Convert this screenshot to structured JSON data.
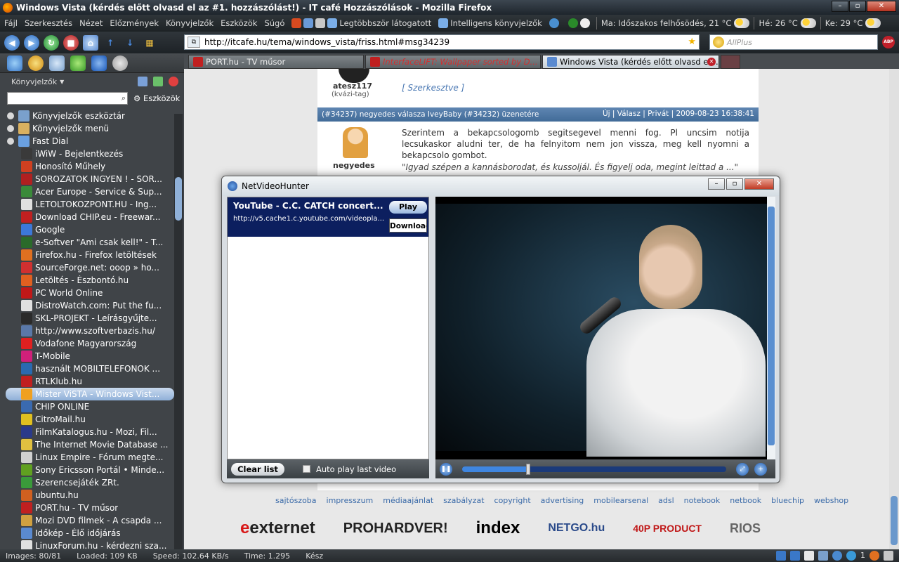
{
  "window": {
    "title": "Windows Vista (kérdés előtt olvasd el az #1. hozzászólást!) - IT café Hozzászólások - Mozilla Firefox"
  },
  "menu": {
    "items": [
      "Fájl",
      "Szerkesztés",
      "Nézet",
      "Előzmények",
      "Könyvjelzők",
      "Eszközök",
      "Súgó"
    ],
    "most_visited": "Legtöbbször látogatott",
    "smart_bookmarks": "Intelligens könyvjelzők",
    "weather_now": "Ma: Időszakos felhősödés, 21 °C",
    "weather_mon": "Hé: 26 °C",
    "weather_tue": "Ke: 29 °C"
  },
  "nav": {
    "url": "http://itcafe.hu/tema/windows_vista/friss.html#msg34239",
    "search_placeholder": "AllPlus",
    "adblock_label": "ABP"
  },
  "sidebar": {
    "title": "Könyvjelzők",
    "tools_label": "Eszközök",
    "tree": [
      {
        "label": "Könyvjelzők eszköztár",
        "level": 0,
        "color": "#7aa0cc"
      },
      {
        "label": "Könyvjelzők menü",
        "level": 0,
        "color": "#d8b060"
      },
      {
        "label": "Fast Dial",
        "level": 1,
        "color": "#6aa0e0"
      },
      {
        "label": "iWiW - Bejelentkezés",
        "level": 2,
        "color": "#3a3a3a"
      },
      {
        "label": "Honosító Műhely",
        "level": 2,
        "color": "#d04020"
      },
      {
        "label": "SOROZATOK INGYEN ! - SOR...",
        "level": 2,
        "color": "#b02020"
      },
      {
        "label": "Acer Europe - Service & Sup...",
        "level": 2,
        "color": "#3a8a3a"
      },
      {
        "label": "LETOLTOKOZPONT.HU - Ing...",
        "level": 2,
        "color": "#e0e0e0"
      },
      {
        "label": "Download CHIP.eu - Freewar...",
        "level": 2,
        "color": "#c02020"
      },
      {
        "label": "Google",
        "level": 2,
        "color": "#3c78d8"
      },
      {
        "label": "e-Softver \"Ami csak kell!\" - T...",
        "level": 2,
        "color": "#2a6a2a"
      },
      {
        "label": "Firefox.hu - Firefox letöltések",
        "level": 2,
        "color": "#e07020"
      },
      {
        "label": "SourceForge.net: ooop » ho...",
        "level": 2,
        "color": "#d03030"
      },
      {
        "label": "Letöltés - Észbontó.hu",
        "level": 2,
        "color": "#e06020"
      },
      {
        "label": "PC World Online",
        "level": 2,
        "color": "#c01818"
      },
      {
        "label": "DistroWatch.com: Put the fu...",
        "level": 2,
        "color": "#e0e0e0"
      },
      {
        "label": "SKL-PROJEKT - Leírásgyűjte...",
        "level": 2,
        "color": "#2a2a2a"
      },
      {
        "label": "http://www.szoftverbazis.hu/",
        "level": 2,
        "color": "#5a78a8"
      },
      {
        "label": "Vodafone Magyarország",
        "level": 2,
        "color": "#e02020"
      },
      {
        "label": "T-Mobile",
        "level": 2,
        "color": "#d0207a"
      },
      {
        "label": "használt MOBILTELEFONOK ...",
        "level": 2,
        "color": "#2a6ab0"
      },
      {
        "label": "RTLKlub.hu",
        "level": 2,
        "color": "#c02020"
      },
      {
        "label": "Mister ViSTA - Windows Vist...",
        "level": 2,
        "color": "#f0a020",
        "selected": true
      },
      {
        "label": "CHIP ONLINE",
        "level": 2,
        "color": "#3a6ab0"
      },
      {
        "label": "CitroMail.hu",
        "level": 2,
        "color": "#e0c020"
      },
      {
        "label": "FilmKatalogus.hu - Mozi, Fil...",
        "level": 2,
        "color": "#2a3a8a"
      },
      {
        "label": "The Internet Movie Database ...",
        "level": 2,
        "color": "#e0c040"
      },
      {
        "label": "Linux Empire - Fórum megte...",
        "level": 2,
        "color": "#d0d0d0"
      },
      {
        "label": "Sony Ericsson Portál • Minde...",
        "level": 2,
        "color": "#60a020"
      },
      {
        "label": "Szerencsejáték ZRt.",
        "level": 2,
        "color": "#3a9a3a"
      },
      {
        "label": "ubuntu.hu",
        "level": 2,
        "color": "#d06020"
      },
      {
        "label": "PORT.hu - TV műsor",
        "level": 2,
        "color": "#c02020"
      },
      {
        "label": "Mozi DVD filmek - A csapda ...",
        "level": 2,
        "color": "#d0a040"
      },
      {
        "label": "Időkép - Élő időjárás",
        "level": 2,
        "color": "#5a8ad0"
      },
      {
        "label": "LinuxForum.hu - kérdezni sza...",
        "level": 2,
        "color": "#e0e0e0"
      }
    ]
  },
  "tabs": [
    {
      "label": "PORT.hu - TV műsor",
      "active": false,
      "color": "#c02020"
    },
    {
      "label": "InterfaceLIFT: Wallpaper sorted by D...",
      "active": false,
      "color": "#c02020"
    },
    {
      "label": "Windows Vista (kérdés előtt olvasd el ...",
      "active": true,
      "color": "#5a8ad0"
    }
  ],
  "post": {
    "user1": "atesz117",
    "user1_rank": "(kvázi-tag)",
    "edited": "[ Szerkesztve ]",
    "header_left": "(#34237) negyedes válasza IveyBaby (#34232) üzenetére",
    "header_right": "Új  |  Válasz  |  Privát  |  2009-08-23 16:38:41",
    "user2": "negyedes",
    "text": "Szerintem a bekapcsologomb segitsegevel menni fog. Pl uncsim notija lecsukaskor aludni ter, de ha felnyitom nem jon vissza, meg kell nyomni a bekapcsolo gombot.",
    "quote": "\"Igyad szépen a kannásborodat, és kussoljál. És figyelj oda, megint leittad a ...\""
  },
  "footer": {
    "links": [
      "sajtószoba",
      "impresszum",
      "médiaajánlat",
      "szabályzat",
      "copyright",
      "advertising",
      "mobilearsenal",
      "adsl",
      "notebook",
      "netbook",
      "bluechip",
      "webshop"
    ],
    "logos": [
      "externet",
      "PROHARDVER!",
      "index",
      "NETGO.hu",
      "40P PRODUCT",
      "RIOS"
    ]
  },
  "popup": {
    "title": "NetVideoHunter",
    "video_title": "YouTube - C.C. CATCH concert...",
    "video_url": "http://v5.cache1.c.youtube.com/videopla...",
    "play_label": "Play",
    "download_label": "Download",
    "clear_label": "Clear list",
    "autoplay_label": "Auto play last video",
    "progress": 0.25
  },
  "status": {
    "images": "Images: 80/81",
    "loaded": "Loaded: 109 KB",
    "speed": "Speed: 102.64 KB/s",
    "time": "Time: 1.295",
    "state": "Kész",
    "counter": "1"
  }
}
